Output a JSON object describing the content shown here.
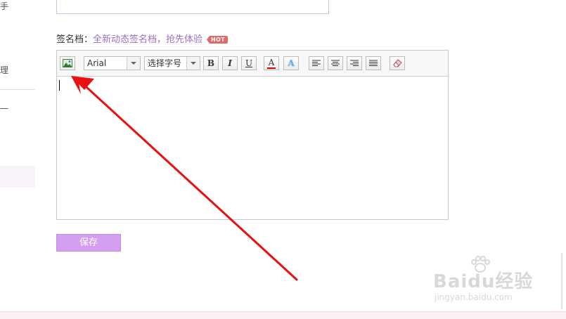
{
  "signature": {
    "label": "签名档：",
    "promo_link": "全新动态签名档，抢先体验",
    "badge": "HOT"
  },
  "toolbar": {
    "icons": [
      "image-icon",
      "bold-icon",
      "italic-icon",
      "underline-icon",
      "font-color-icon",
      "highlight-icon",
      "align-left-icon",
      "align-center-icon",
      "align-right-icon",
      "justify-icon",
      "eraser-icon"
    ],
    "font_family_value": "Arial",
    "font_size_value": "选择字号",
    "bold_label": "B",
    "italic_label": "I",
    "underline_label": "U",
    "font_color_label": "A",
    "highlight_label": "A"
  },
  "save_button": {
    "label": "保存"
  },
  "watermark": {
    "main": "Baidu经验",
    "sub": "jingyan.baidu.com"
  },
  "colors": {
    "accent": "#d49ff0",
    "link": "#9a6fbf",
    "hot_badge": "#e06a6a",
    "arrow": "#e81010"
  }
}
